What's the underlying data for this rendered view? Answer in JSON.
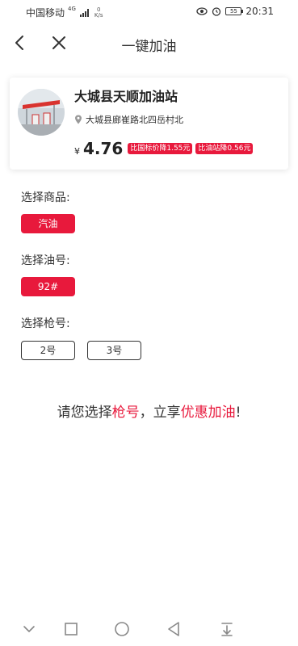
{
  "status_bar": {
    "carrier": "中国移动",
    "network_type": "4G",
    "net_speed_value": "0",
    "net_speed_unit": "K/s",
    "battery": "55",
    "time": "20:31",
    "icons": [
      "signal-icon",
      "eye-icon",
      "alarm-icon",
      "battery-icon"
    ]
  },
  "header": {
    "title": "一键加油",
    "back_icon": "chevron-left-icon",
    "close_icon": "close-icon"
  },
  "station": {
    "name": "大城县天顺加油站",
    "address": "大城县廊崔路北四岳村北",
    "currency": "¥",
    "price": "4.76",
    "badges": [
      "比国标价降1.55元",
      "比油站降0.56元"
    ],
    "accent_color": "#e8193c"
  },
  "product_section": {
    "label": "选择商品:",
    "options": [
      {
        "label": "汽油",
        "selected": true
      }
    ]
  },
  "fuel_section": {
    "label": "选择油号:",
    "options": [
      {
        "label": "92#",
        "selected": true
      }
    ]
  },
  "gun_section": {
    "label": "选择枪号:",
    "options": [
      {
        "label": "2号",
        "selected": false
      },
      {
        "label": "3号",
        "selected": false
      }
    ]
  },
  "prompt": {
    "part1": "请您选择",
    "highlight1": "枪号",
    "part2": "，立享",
    "highlight2": "优惠加油",
    "part3": "!"
  },
  "nav_bar": {
    "icons": [
      "collapse-icon",
      "square-icon",
      "circle-home-icon",
      "triangle-back-icon",
      "download-icon"
    ]
  }
}
